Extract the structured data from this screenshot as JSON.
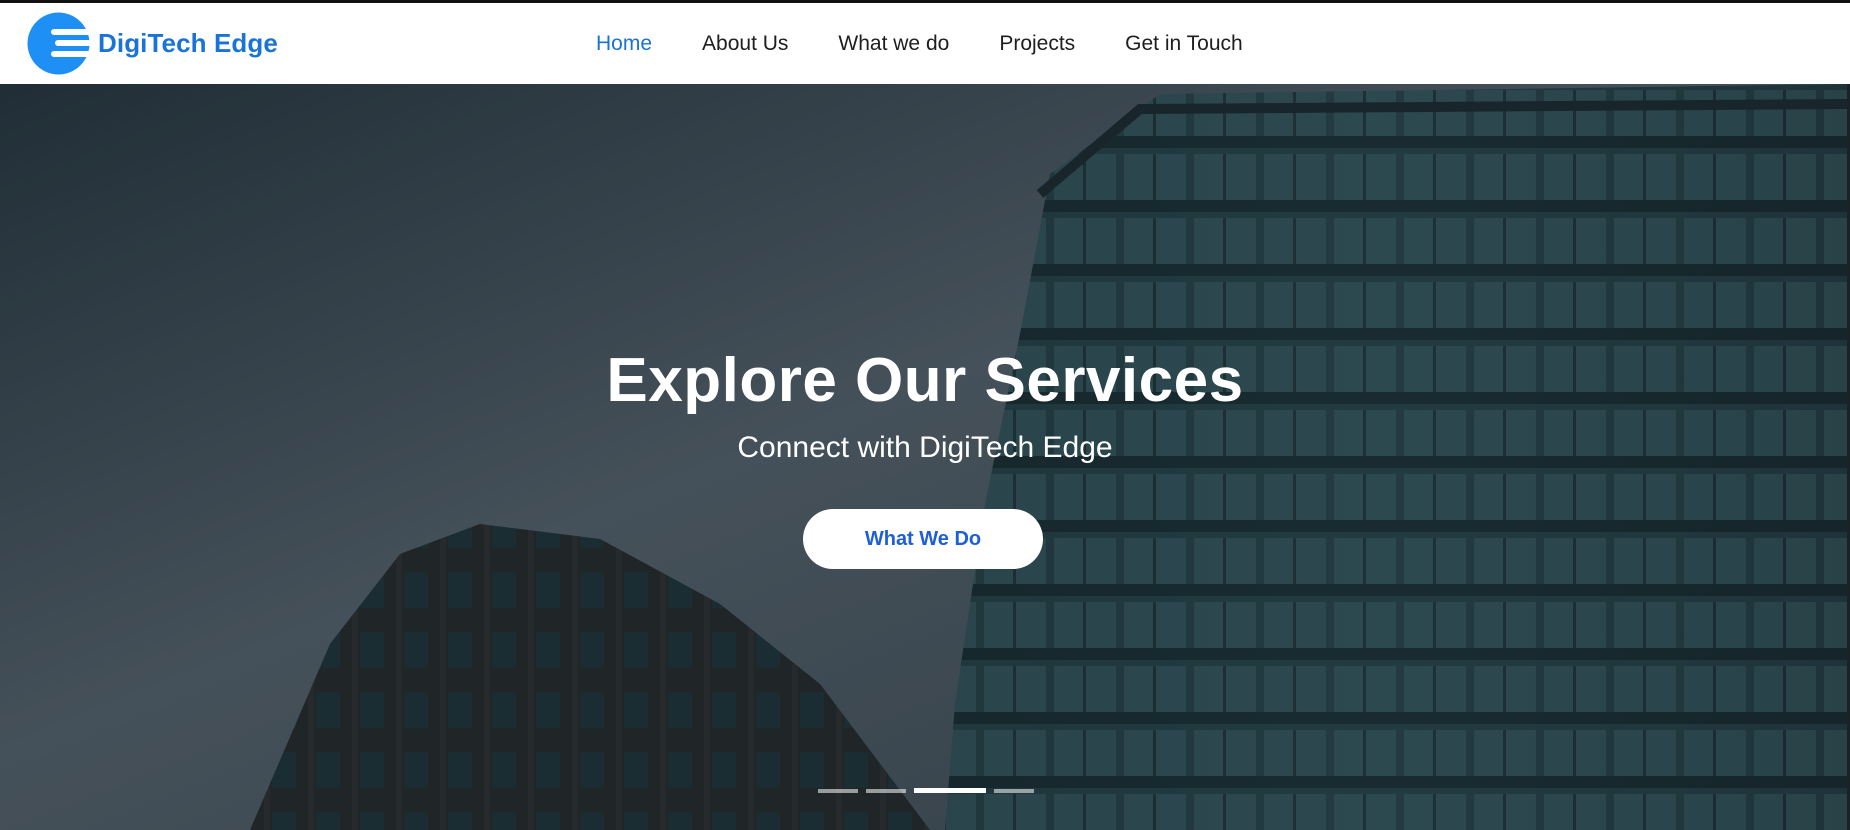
{
  "brand": {
    "name": "DigiTech Edge",
    "logo_icon": "circle-stripes-logo-icon",
    "color": "#1a73d9"
  },
  "nav": {
    "items": [
      {
        "label": "Home",
        "active": true
      },
      {
        "label": "About Us",
        "active": false
      },
      {
        "label": "What we do",
        "active": false
      },
      {
        "label": "Projects",
        "active": false
      },
      {
        "label": "Get in Touch",
        "active": false
      }
    ],
    "active_color": "#1a73d9"
  },
  "hero": {
    "title": "Explore Our Services",
    "subtitle": "Connect with DigiTech Edge",
    "button_label": "What We Do",
    "button_text_color": "#1f5fd6",
    "slides": {
      "count": 4,
      "active_index": 2
    }
  }
}
